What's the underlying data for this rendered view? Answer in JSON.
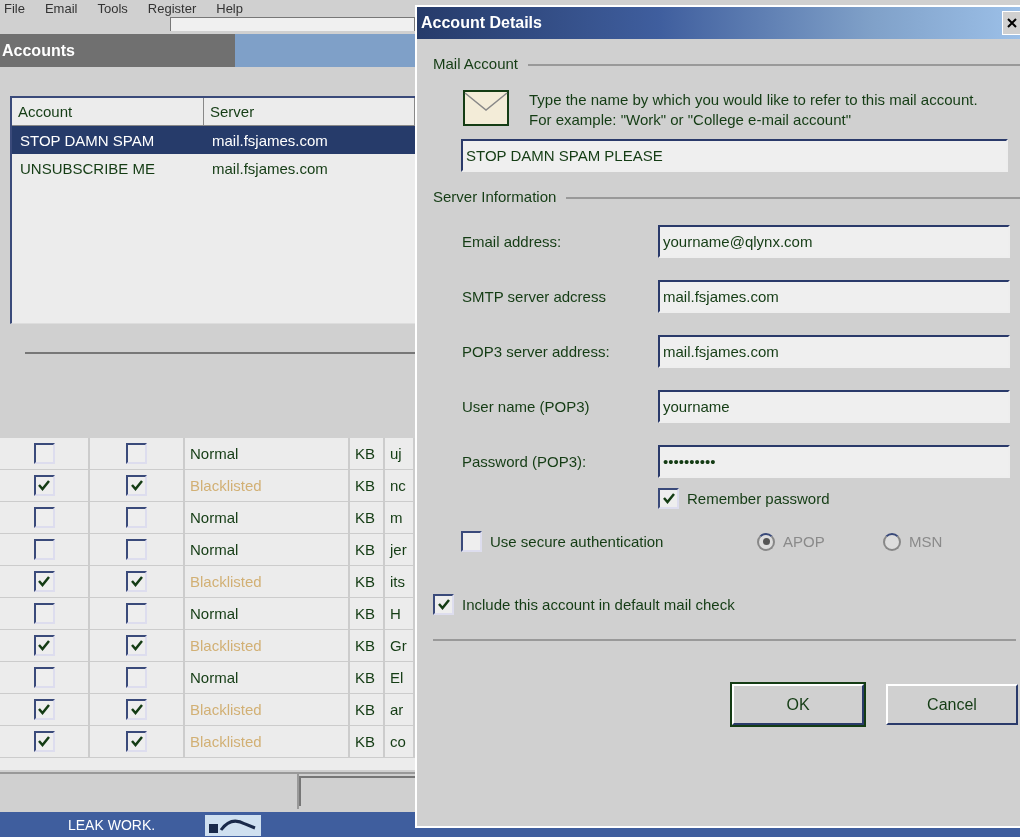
{
  "menu": [
    "File",
    "Email",
    "Tools",
    "Register",
    "Help"
  ],
  "accounts": {
    "title": "Accounts",
    "columns": [
      "Account",
      "Server"
    ],
    "rows": [
      {
        "account": "STOP DAMN SPAM",
        "server": "mail.fsjames.com",
        "selected": true
      },
      {
        "account": "UNSUBSCRIBE ME",
        "server": "mail.fsjames.com",
        "selected": false
      }
    ]
  },
  "messages": [
    {
      "delete": false,
      "bounce": false,
      "status": "Normal",
      "kind": "normal",
      "size": "KB",
      "column_5": "uj"
    },
    {
      "delete": true,
      "bounce": true,
      "status": "Blacklisted",
      "kind": "blacklisted",
      "size": "KB",
      "column_5": "nc"
    },
    {
      "delete": false,
      "bounce": false,
      "status": "Normal",
      "kind": "normal",
      "size": "KB",
      "column_5": "m"
    },
    {
      "delete": false,
      "bounce": false,
      "status": "Normal",
      "kind": "normal",
      "size": "KB",
      "column_5": "jer"
    },
    {
      "delete": true,
      "bounce": true,
      "status": "Blacklisted",
      "kind": "blacklisted",
      "size": "KB",
      "column_5": "its"
    },
    {
      "delete": false,
      "bounce": false,
      "status": "Normal",
      "kind": "normal",
      "size": "KB",
      "column_5": "H"
    },
    {
      "delete": true,
      "bounce": true,
      "status": "Blacklisted",
      "kind": "blacklisted",
      "size": "KB",
      "column_5": "Gr"
    },
    {
      "delete": false,
      "bounce": false,
      "status": "Normal",
      "kind": "normal",
      "size": "KB",
      "column_5": "El"
    },
    {
      "delete": true,
      "bounce": true,
      "status": "Blacklisted",
      "kind": "blacklisted",
      "size": "KB",
      "column_5": "ar"
    },
    {
      "delete": true,
      "bounce": true,
      "status": "Blacklisted",
      "kind": "blacklisted",
      "size": "KB",
      "column_5": "co"
    }
  ],
  "taskbar": {
    "text": "LEAK WORK."
  },
  "dialog": {
    "title": "Account Details",
    "mail_account": {
      "title": "Mail Account",
      "description": "Type the name by which you would like to refer to this mail account. For example: \"Work\" or \"College e-mail account\"",
      "name": "STOP DAMN SPAM PLEASE"
    },
    "server_information": {
      "title": "Server Information",
      "fields": [
        {
          "label": "Email address:",
          "value": "yourname@qlynx.com"
        },
        {
          "label": "SMTP server adcress",
          "value": "mail.fsjames.com"
        },
        {
          "label": "POP3 server address:",
          "value": "mail.fsjames.com"
        },
        {
          "label": "User name (POP3)",
          "value": "yourname"
        },
        {
          "label": "Password (POP3):",
          "value": "••••••••••"
        }
      ],
      "remember_password": {
        "label": "Remember password",
        "checked": true
      },
      "secure_authentication": {
        "label": "Use secure authentication",
        "checked": false
      },
      "auth_options": [
        {
          "label": "APOP",
          "selected": true,
          "disabled": true
        },
        {
          "label": "MSN",
          "selected": false,
          "disabled": true
        }
      ]
    },
    "include_in_check": {
      "label": "Include this account in default mail check",
      "checked": true
    },
    "buttons": [
      "OK",
      "Cancel"
    ]
  }
}
